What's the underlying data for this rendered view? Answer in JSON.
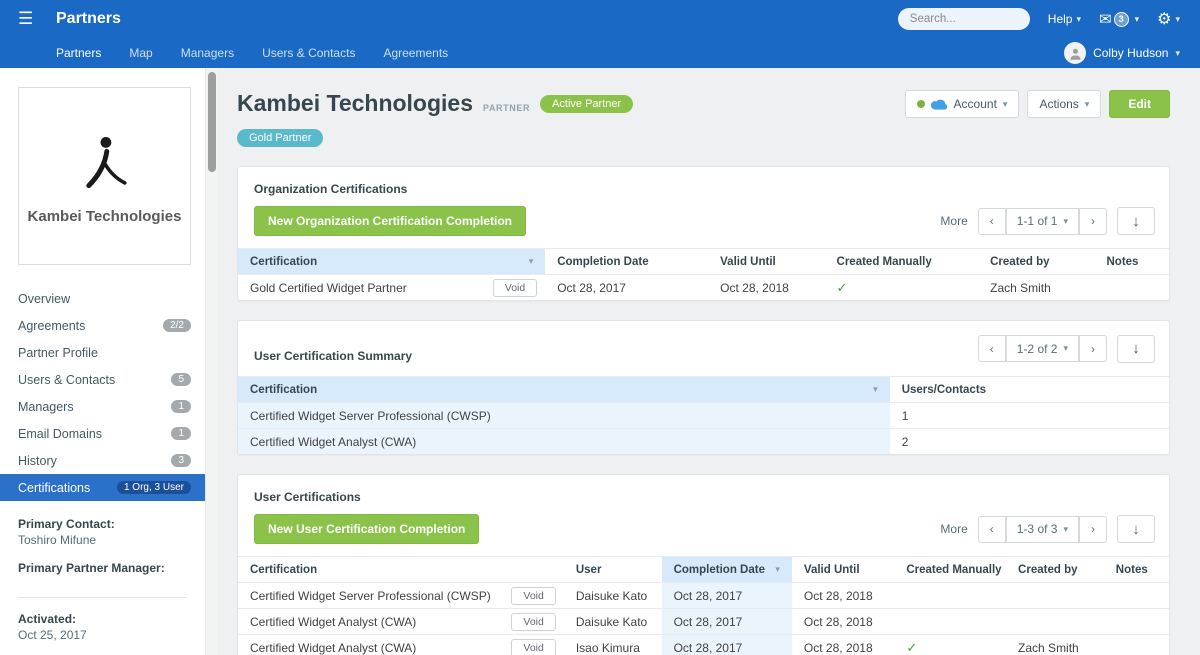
{
  "topbar": {
    "app_title": "Partners",
    "nav": [
      {
        "label": "Partners"
      },
      {
        "label": "Map"
      },
      {
        "label": "Managers"
      },
      {
        "label": "Users & Contacts"
      },
      {
        "label": "Agreements"
      }
    ],
    "search_placeholder": "Search...",
    "help_label": "Help",
    "mail_badge": "3",
    "user_name": "Colby Hudson"
  },
  "sidebar": {
    "logo_text": "Kambei Technologies",
    "items": [
      {
        "label": "Overview",
        "badge": ""
      },
      {
        "label": "Agreements",
        "badge": "2/2"
      },
      {
        "label": "Partner Profile",
        "badge": ""
      },
      {
        "label": "Users & Contacts",
        "badge": "5"
      },
      {
        "label": "Managers",
        "badge": "1"
      },
      {
        "label": "Email Domains",
        "badge": "1"
      },
      {
        "label": "History",
        "badge": "3"
      },
      {
        "label": "Certifications",
        "badge": "1 Org, 3 User"
      }
    ],
    "primary_contact_label": "Primary Contact:",
    "primary_contact": "Toshiro Mifune",
    "primary_manager_label": "Primary Partner Manager:",
    "activated_label": "Activated:",
    "activated": "Oct 25, 2017"
  },
  "header": {
    "title": "Kambei Technologies",
    "type_label": "PARTNER",
    "status_badge": "Active Partner",
    "tier_badge": "Gold Partner",
    "account_label": "Account",
    "actions_label": "Actions",
    "edit_label": "Edit"
  },
  "org_certifications": {
    "title": "Organization Certifications",
    "new_button": "New Organization Certification Completion",
    "more_label": "More",
    "pagination": "1-1 of 1",
    "columns": [
      "Certification",
      "Completion Date",
      "Valid Until",
      "Created Manually",
      "Created by",
      "Notes"
    ],
    "rows": [
      {
        "certification": "Gold Certified Widget Partner",
        "void_label": "Void",
        "completion_date": "Oct 28, 2017",
        "valid_until": "Oct 28, 2018",
        "created_manually": "✓",
        "created_by": "Zach Smith",
        "notes": ""
      }
    ]
  },
  "user_cert_summary": {
    "title": "User Certification Summary",
    "pagination": "1-2 of 2",
    "columns": [
      "Certification",
      "Users/Contacts"
    ],
    "rows": [
      {
        "certification": "Certified Widget Server Professional (CWSP)",
        "count": "1"
      },
      {
        "certification": "Certified Widget Analyst (CWA)",
        "count": "2"
      }
    ]
  },
  "user_certifications": {
    "title": "User Certifications",
    "new_button": "New User Certification Completion",
    "more_label": "More",
    "pagination": "1-3 of 3",
    "columns": [
      "Certification",
      "User",
      "Completion Date",
      "Valid Until",
      "Created Manually",
      "Created by",
      "Notes"
    ],
    "rows": [
      {
        "certification": "Certified Widget Server Professional (CWSP)",
        "void_label": "Void",
        "user": "Daisuke Kato",
        "completion_date": "Oct 28, 2017",
        "valid_until": "Oct 28, 2018",
        "created_manually": "",
        "created_by": "",
        "notes": ""
      },
      {
        "certification": "Certified Widget Analyst (CWA)",
        "void_label": "Void",
        "user": "Daisuke Kato",
        "completion_date": "Oct 28, 2017",
        "valid_until": "Oct 28, 2018",
        "created_manually": "",
        "created_by": "",
        "notes": ""
      },
      {
        "certification": "Certified Widget Analyst (CWA)",
        "void_label": "Void",
        "user": "Isao Kimura",
        "completion_date": "Oct 28, 2017",
        "valid_until": "Oct 28, 2018",
        "created_manually": "✓",
        "created_by": "Zach Smith",
        "notes": ""
      }
    ]
  }
}
